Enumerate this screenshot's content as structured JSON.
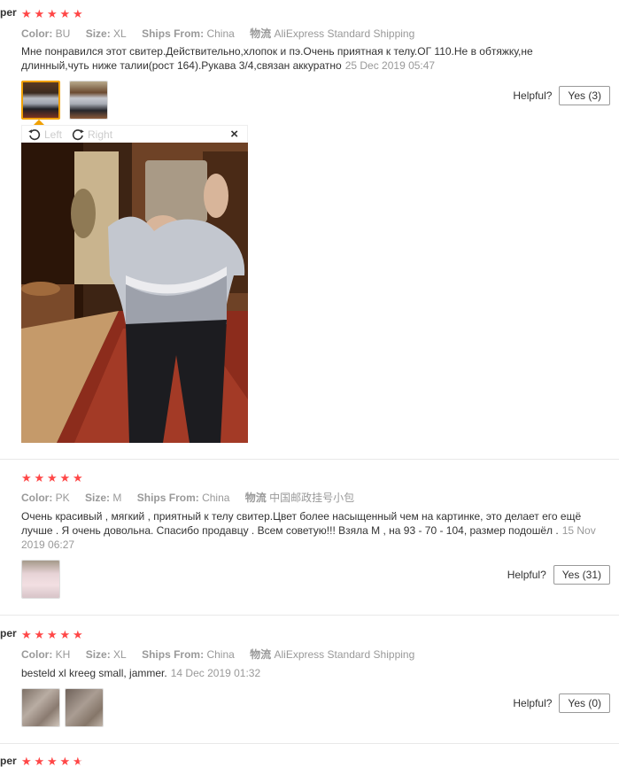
{
  "reviews": [
    {
      "buyer": "per",
      "rating": 5,
      "color_label": "Color:",
      "color_value": "BU",
      "size_label": "Size:",
      "size_value": "XL",
      "ships_label": "Ships From:",
      "ships_value": "China",
      "logistics_label": "物流",
      "logistics_value": "AliExpress Standard Shipping",
      "text": "Мне понравился этот свитер.Действительно,хлопок и пэ.Очень приятная к телу.ОГ 110.Не в обтяжку,не длинный,чуть ниже талии(рост 164).Рукава 3/4,связан аккуратно",
      "date": "25 Dec 2019 05:47",
      "helpful_label": "Helpful?",
      "yes_label": "Yes (3)"
    },
    {
      "buyer": "",
      "rating": 5,
      "color_label": "Color:",
      "color_value": "PK",
      "size_label": "Size:",
      "size_value": "M",
      "ships_label": "Ships From:",
      "ships_value": "China",
      "logistics_label": "物流",
      "logistics_value": "中国邮政挂号小包",
      "text": "Очень красивый , мягкий , приятный к телу свитер.Цвет более насыщенный чем на картинке, это делает его ещё лучше . Я очень довольна. Спасибо продавцу . Всем советую!!! Взяла М , на 93 - 70 - 104, размер подошёл .",
      "date": "15 Nov 2019 06:27",
      "helpful_label": "Helpful?",
      "yes_label": "Yes (31)"
    },
    {
      "buyer": "per",
      "rating": 5,
      "color_label": "Color:",
      "color_value": "KH",
      "size_label": "Size:",
      "size_value": "XL",
      "ships_label": "Ships From:",
      "ships_value": "China",
      "logistics_label": "物流",
      "logistics_value": "AliExpress Standard Shipping",
      "text": "besteld xl kreeg small, jammer.",
      "date": "14 Dec 2019 01:32",
      "helpful_label": "Helpful?",
      "yes_label": "Yes (0)"
    },
    {
      "buyer": "per",
      "rating": 4.5
    }
  ],
  "viewer": {
    "rotate_left_label": "Left",
    "rotate_right_label": "Right",
    "close_label": "×"
  },
  "colors": {
    "star": "#ff4747",
    "active_thumb_border": "#f0a000",
    "muted_text": "#999999"
  }
}
